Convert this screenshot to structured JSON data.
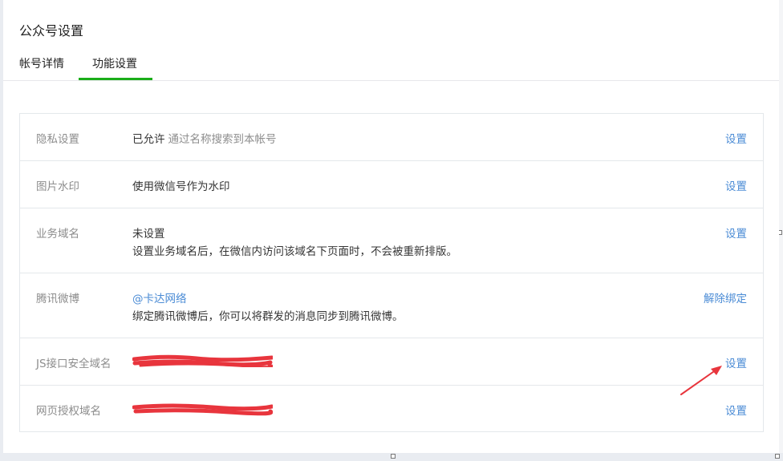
{
  "page": {
    "title": "公众号设置"
  },
  "tabs": [
    {
      "label": "帐号详情"
    },
    {
      "label": "功能设置"
    }
  ],
  "settings": {
    "privacy": {
      "label": "隐私设置",
      "value": "已允许",
      "desc": "通过名称搜索到本帐号",
      "action": "设置"
    },
    "watermark": {
      "label": "图片水印",
      "value": "使用微信号作为水印",
      "action": "设置"
    },
    "business_domain": {
      "label": "业务域名",
      "value": "未设置",
      "desc": "设置业务域名后，在微信内访问该域名下页面时，不会被重新排版。",
      "action": "设置"
    },
    "tencent_weibo": {
      "label": "腾讯微博",
      "value": "@卡达网络",
      "desc": "绑定腾讯微博后，你可以将群发的消息同步到腾讯微博。",
      "action": "解除绑定"
    },
    "js_domain": {
      "label": "JS接口安全域名",
      "action": "设置"
    },
    "oauth_domain": {
      "label": "网页授权域名",
      "action": "设置"
    }
  },
  "colors": {
    "accent_green": "#1aad19",
    "link_blue": "#4a8bd5",
    "annotation_red": "#e8353d"
  }
}
